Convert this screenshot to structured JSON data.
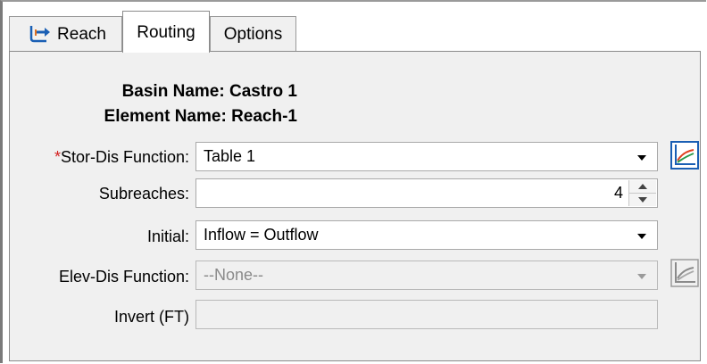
{
  "tabs": [
    {
      "label": "Reach",
      "icon": "reach-icon"
    },
    {
      "label": "Routing",
      "active": true
    },
    {
      "label": "Options"
    }
  ],
  "info": {
    "basin_label": "Basin Name:",
    "basin_value": "Castro 1",
    "element_label": "Element Name:",
    "element_value": "Reach-1"
  },
  "form": {
    "stor_dis": {
      "required_mark": "*",
      "label": "Stor-Dis Function:",
      "value": "Table 1"
    },
    "subreaches": {
      "label": "Subreaches:",
      "value": "4"
    },
    "initial": {
      "label": "Initial:",
      "value": "Inflow = Outflow"
    },
    "elev_dis": {
      "label": "Elev-Dis Function:",
      "value": "--None--",
      "disabled": true
    },
    "invert": {
      "label": "Invert (FT)",
      "value": "",
      "disabled": true
    }
  },
  "colors": {
    "required": "#d42020",
    "panel": "#f0f0f0"
  }
}
